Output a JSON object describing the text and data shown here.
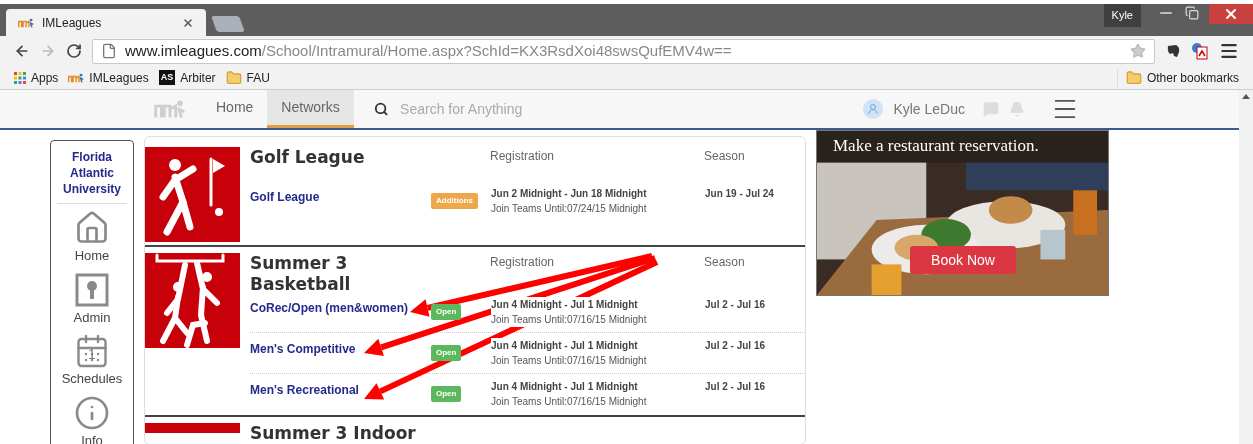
{
  "browser": {
    "tabs": [
      {
        "title": "IMLeagues",
        "selected": true
      }
    ],
    "profile": "Kyle",
    "url": {
      "host": "www.imleagues.com",
      "path": "/School/Intramural/Home.aspx?SchId=KX3RsdXoi48swsQufEMV4w=="
    },
    "bookmarks": [
      {
        "label": "Apps",
        "kind": "apps"
      },
      {
        "label": "IMLeagues",
        "kind": "site"
      },
      {
        "label": "Arbiter",
        "kind": "arbiter",
        "badge": "AS"
      },
      {
        "label": "FAU",
        "kind": "folder"
      }
    ],
    "other_bookmarks": "Other bookmarks"
  },
  "site_nav": {
    "items": [
      {
        "label": "Home",
        "selected": false
      },
      {
        "label": "Networks",
        "selected": true
      }
    ],
    "search": {
      "placeholder": "Search for Anything"
    },
    "user": "Kyle LeDuc"
  },
  "sidebar": {
    "school": "Florida Atlantic University",
    "items": [
      {
        "label": "Home",
        "kind": "home"
      },
      {
        "label": "Admin",
        "kind": "admin"
      },
      {
        "label": "Schedules",
        "kind": "schedules",
        "day": "1"
      },
      {
        "label": "Info",
        "kind": "info"
      }
    ]
  },
  "leagues": [
    {
      "title": "Golf League",
      "kind": "golf",
      "columns": [
        "Registration",
        "Season"
      ],
      "divisions": [
        {
          "name": "Golf League",
          "status": {
            "label": "Additions",
            "kind": "additions"
          },
          "registration": "Jun 2 Midnight - Jun 18 Midnight",
          "join": "Join Teams Until:07/24/15 Midnight",
          "season": "Jun 19 - Jul 24"
        }
      ]
    },
    {
      "title": "Summer 3 Basketball",
      "kind": "basketball",
      "columns": [
        "Registration",
        "Season"
      ],
      "divisions": [
        {
          "name": "CoRec/Open (men&women)",
          "status": {
            "label": "Open",
            "kind": "open"
          },
          "registration": "Jun 4 Midnight - Jul 1 Midnight",
          "join": "Join Teams Until:07/16/15 Midnight",
          "season": "Jul 2 - Jul 16"
        },
        {
          "name": "Men's Competitive",
          "status": {
            "label": "Open",
            "kind": "open"
          },
          "registration": "Jun 4 Midnight - Jul 1 Midnight",
          "join": "Join Teams Until:07/16/15 Midnight",
          "season": "Jul 2 - Jul 16"
        },
        {
          "name": "Men's Recreational",
          "status": {
            "label": "Open",
            "kind": "open"
          },
          "registration": "Jun 4 Midnight - Jul 1 Midnight",
          "join": "Join Teams Until:07/16/15 Midnight",
          "season": "Jul 2 - Jul 16"
        }
      ]
    },
    {
      "title": "Summer 3 Indoor",
      "kind": "other"
    }
  ],
  "ad": {
    "headline": "Make a restaurant reservation.",
    "button": "Book Now"
  }
}
